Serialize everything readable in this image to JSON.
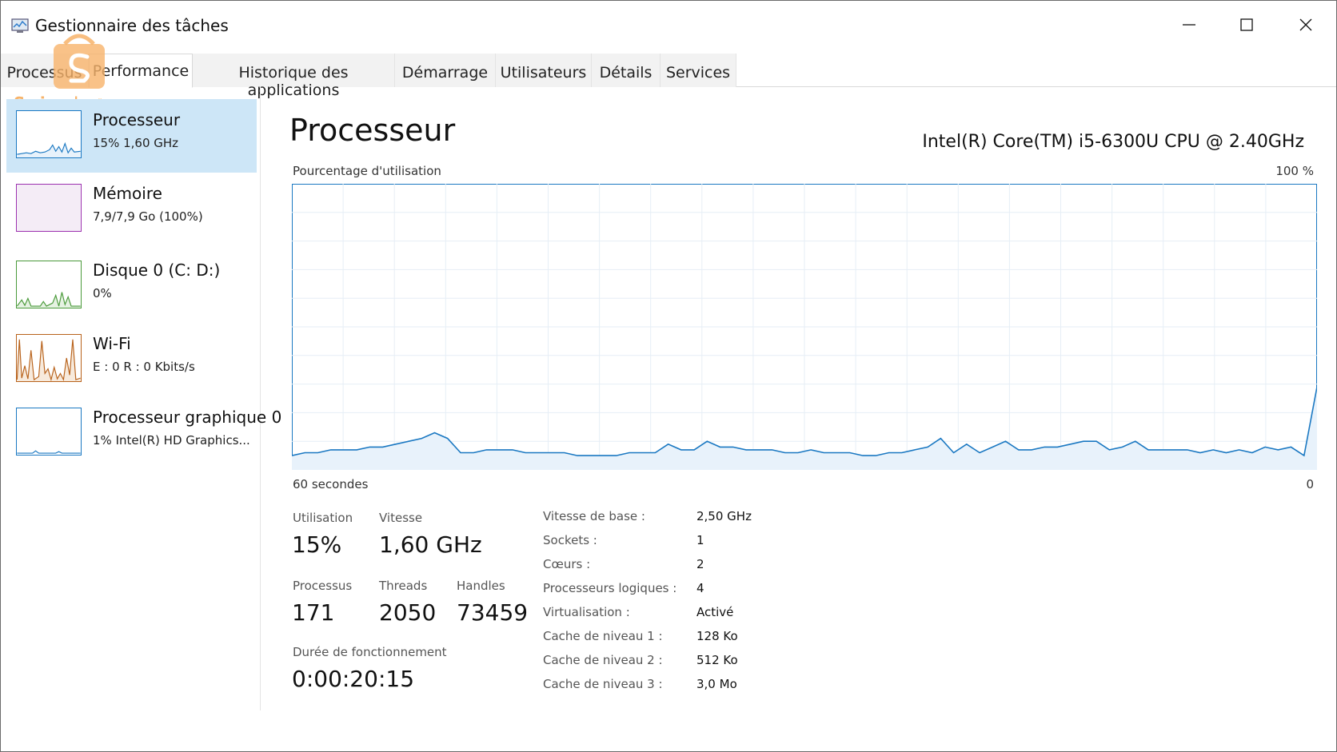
{
  "window": {
    "title": "Gestionnaire des tâches"
  },
  "watermark": {
    "text": "Swiga | سويقة"
  },
  "tabs": [
    {
      "label": "Processus"
    },
    {
      "label": "Performance"
    },
    {
      "label": "Historique des applications"
    },
    {
      "label": "Démarrage"
    },
    {
      "label": "Utilisateurs"
    },
    {
      "label": "Détails"
    },
    {
      "label": "Services"
    }
  ],
  "sidebar": {
    "items": [
      {
        "name": "Processeur",
        "sub": "15%  1,60 GHz",
        "color": "#1a78c2"
      },
      {
        "name": "Mémoire",
        "sub": "7,9/7,9 Go (100%)",
        "color": "#9b2fae"
      },
      {
        "name": "Disque 0 (C: D:)",
        "sub": "0%",
        "color": "#4a9a3a"
      },
      {
        "name": "Wi-Fi",
        "sub": "E : 0 R : 0 Kbits/s",
        "color": "#b8621b"
      },
      {
        "name": "Processeur graphique 0",
        "sub": "1%  Intel(R) HD Graphics...",
        "color": "#1a78c2"
      }
    ]
  },
  "main": {
    "title": "Processeur",
    "cpu_model": "Intel(R) Core(TM) i5-6300U CPU @ 2.40GHz",
    "graph_label": "Pourcentage d'utilisation",
    "graph_max": "100 %",
    "graph_time": "60 secondes",
    "graph_min": "0",
    "stats": {
      "utilisation_label": "Utilisation",
      "utilisation_value": "15%",
      "vitesse_label": "Vitesse",
      "vitesse_value": "1,60 GHz",
      "processus_label": "Processus",
      "processus_value": "171",
      "threads_label": "Threads",
      "threads_value": "2050",
      "handles_label": "Handles",
      "handles_value": "73459",
      "uptime_label": "Durée de fonctionnement",
      "uptime_value": "0:00:20:15"
    },
    "specs": [
      {
        "label": "Vitesse de base :",
        "value": "2,50 GHz"
      },
      {
        "label": "Sockets :",
        "value": "1"
      },
      {
        "label": "Cœurs :",
        "value": "2"
      },
      {
        "label": "Processeurs logiques :",
        "value": "4"
      },
      {
        "label": "Virtualisation :",
        "value": "Activé"
      },
      {
        "label": "Cache de niveau 1 :",
        "value": "128 Ko"
      },
      {
        "label": "Cache de niveau 2 :",
        "value": "512 Ko"
      },
      {
        "label": "Cache de niveau 3 :",
        "value": "3,0 Mo"
      }
    ]
  },
  "colors": {
    "cpu_line": "#1a78c2",
    "cpu_fill": "#e8f2fb",
    "grid": "#e6eef6",
    "selected_bg": "#cde6f7"
  },
  "chart_data": {
    "type": "area",
    "ylim": [
      0,
      100
    ],
    "xlim": [
      60,
      0
    ],
    "xlabel": "60 secondes",
    "ylabel": "Pourcentage d'utilisation",
    "grid": true,
    "series": [
      {
        "values": [
          5,
          6,
          6,
          7,
          7,
          7,
          8,
          8,
          9,
          10,
          11,
          13,
          11,
          6,
          6,
          7,
          7,
          7,
          6,
          6,
          6,
          6,
          5,
          5,
          5,
          5,
          6,
          6,
          6,
          9,
          7,
          7,
          10,
          8,
          8,
          7,
          7,
          7,
          6,
          6,
          7,
          6,
          6,
          6,
          5,
          5,
          6,
          6,
          7,
          8,
          11,
          6,
          9,
          6,
          8,
          10,
          7,
          7,
          8,
          8,
          9,
          10,
          10,
          7,
          8,
          10,
          7,
          7,
          7,
          7,
          6,
          7,
          6,
          7,
          6,
          8,
          7,
          8,
          5,
          29
        ]
      }
    ]
  }
}
